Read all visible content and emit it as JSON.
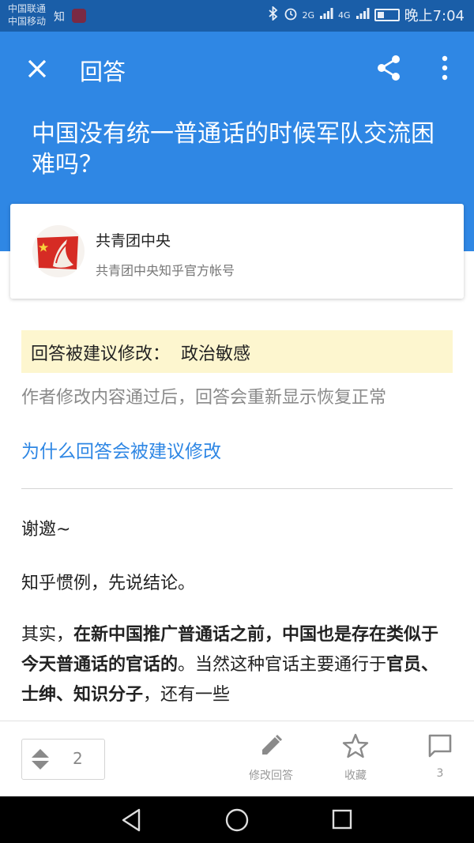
{
  "status_bar": {
    "carrier_1": "中国联通",
    "carrier_2": "中国移动",
    "notification_app": "知",
    "network_1": "2G",
    "network_2": "4G",
    "time": "晚上7:04"
  },
  "header": {
    "title": "回答",
    "question": "中国没有统一普通话的时候军队交流困难吗？"
  },
  "author": {
    "name": "共青团中央",
    "description": "共青团中央知乎官方帐号"
  },
  "notice": {
    "text": "回答被建议修改：  政治敏感"
  },
  "hint": {
    "text": "作者修改内容通过后，回答会重新显示恢复正常",
    "link": "为什么回答会被建议修改"
  },
  "answer": {
    "p1": "谢邀~",
    "p2": "知乎惯例，先说结论。",
    "p3": {
      "s1": "其实，",
      "b1": "在新中国推广普通话之前，中国也是存在类似于今天普通话的官话的",
      "s2": "。当然这种官话主要通行于",
      "b2": "官员、士绅、知识分子",
      "s3": "，还有一些"
    }
  },
  "bottom_bar": {
    "vote_count": "2",
    "edit_label": "修改回答",
    "favorite_label": "收藏",
    "comment_count": "3"
  }
}
